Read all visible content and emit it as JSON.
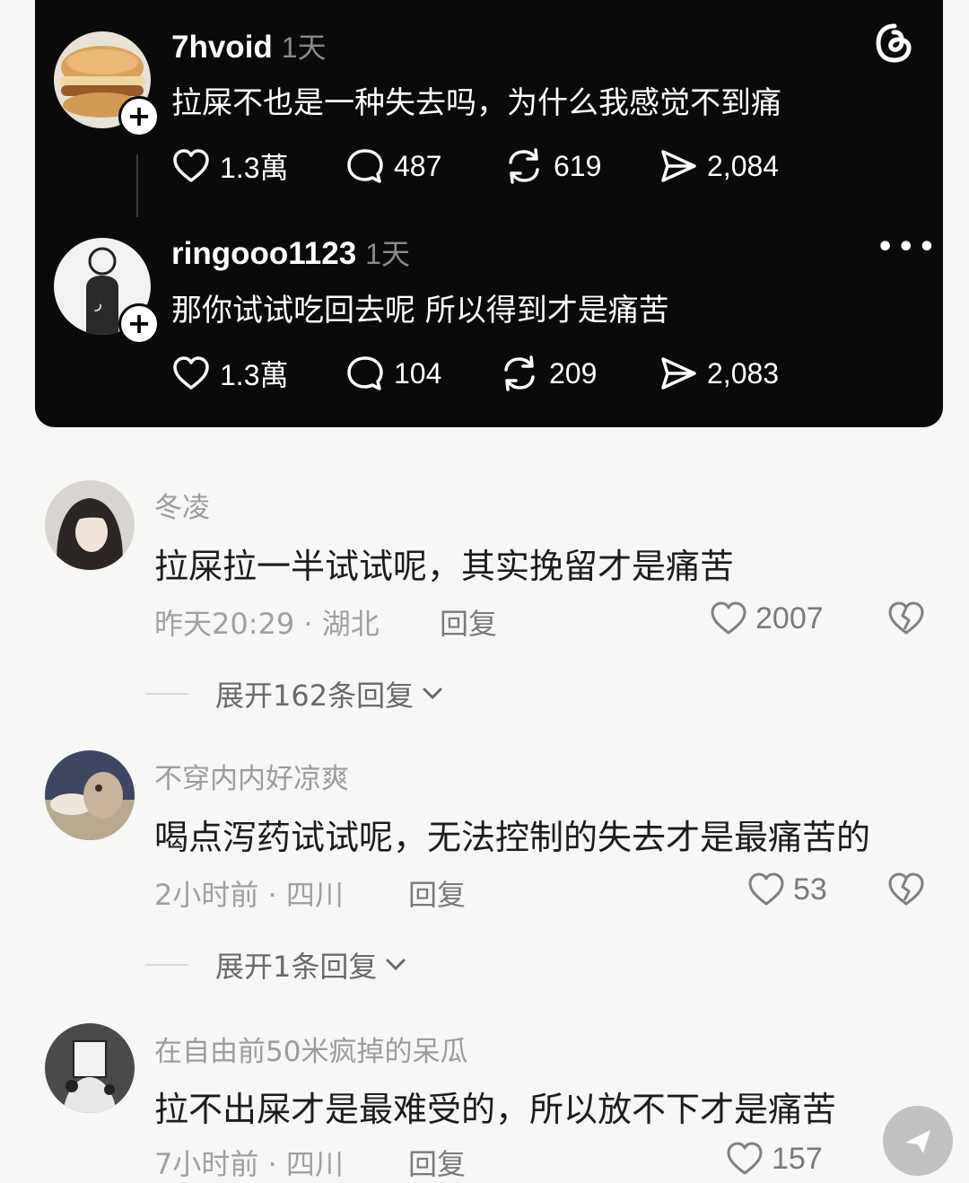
{
  "threads_card": {
    "posts": [
      {
        "username": "7hvoid",
        "time": "1天",
        "text": "拉屎不也是一种失去吗，为什么我感觉不到痛",
        "likes": "1.3萬",
        "comments": "487",
        "reposts": "619",
        "shares": "2,084",
        "avatar_icon": "burger-avatar"
      },
      {
        "username": "ringooo1123",
        "time": "1天",
        "text": "那你试试吃回去呢 所以得到才是痛苦",
        "likes": "1.3萬",
        "comments": "104",
        "reposts": "209",
        "shares": "2,083",
        "avatar_icon": "figure-avatar"
      }
    ],
    "logo_icon": "threads-logo-icon",
    "more_icon": "more-dots-icon"
  },
  "comments": [
    {
      "name": "冬凌",
      "text": "拉屎拉一半试试呢，其实挽留才是痛苦",
      "meta": "昨天20:29 · 湖北",
      "reply_label": "回复",
      "likes": "2007",
      "expand_label": "展开162条回复"
    },
    {
      "name": "不穿内内好凉爽",
      "text": "喝点泻药试试呢，无法控制的失去才是最痛苦的",
      "meta": "2小时前 · 四川",
      "reply_label": "回复",
      "likes": "53",
      "expand_label": "展开1条回复"
    },
    {
      "name": "在自由前50米疯掉的呆瓜",
      "text": "拉不出屎才是最难受的，所以放不下才是痛苦",
      "meta": "7小时前 · 四川",
      "reply_label": "回复",
      "likes": "157"
    }
  ],
  "colors": {
    "card_bg": "#0a0a0a",
    "page_bg": "#f7f7f5",
    "secondary_text": "#9c9c9c"
  }
}
